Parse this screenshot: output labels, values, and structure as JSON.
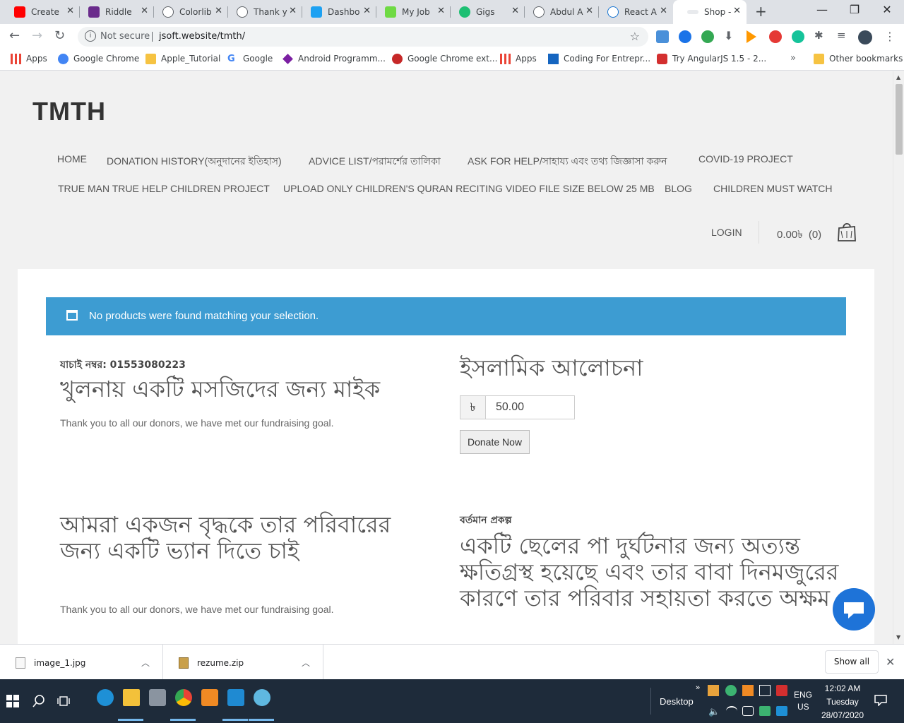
{
  "browser": {
    "tabs": [
      {
        "label": "Create",
        "color": "#ff0000"
      },
      {
        "label": "Riddle",
        "color": "#6a2b8c"
      },
      {
        "label": "Colorlib",
        "color": "#5f6368"
      },
      {
        "label": "Thank y",
        "color": "#5f6368"
      },
      {
        "label": "Dashbo",
        "color": "#1da1f2"
      },
      {
        "label": "My Job",
        "color": "#6fda44"
      },
      {
        "label": "Gigs",
        "color": "#1dbf73"
      },
      {
        "label": "Abdul A",
        "color": "#5f6368"
      },
      {
        "label": "React A",
        "color": "#1976d2"
      },
      {
        "label": "Shop - ",
        "color": "#9aa0a6"
      }
    ],
    "tab_close": "✕",
    "new_tab": "+",
    "window_controls": {
      "minimize": "—",
      "restore": "❐",
      "close": "✕"
    },
    "security_label": "Not secure",
    "url": "jsoft.website/tmth/",
    "bookmarks": [
      {
        "label": "Apps",
        "color": "#ea4335"
      },
      {
        "label": "Google Chrome",
        "color": "#4285f4"
      },
      {
        "label": "Apple_Tutorial",
        "color": "#f6c342"
      },
      {
        "label": "Google",
        "color": "#4285f4"
      },
      {
        "label": "Android Programm...",
        "color": "#7b1fa2"
      },
      {
        "label": "Google Chrome ext...",
        "color": "#c62828"
      },
      {
        "label": "Apps",
        "color": "#ea4335"
      },
      {
        "label": "Coding For Entrepr...",
        "color": "#1565c0"
      },
      {
        "label": "Try AngularJS 1.5 - 2...",
        "color": "#d32f2f"
      }
    ],
    "bookmarks_more": "»",
    "other_bookmarks": "Other bookmarks"
  },
  "site": {
    "title": "TMTH",
    "menu_row1": [
      "HOME",
      "DONATION HISTORY(অনুদানের ইতিহাস)",
      "ADVICE LIST/পরামর্শের তালিকা",
      "ASK FOR HELP/সাহায্য এবং তথ্য জিজ্ঞাসা করুন",
      "COVID-19 PROJECT"
    ],
    "menu_row2": [
      "TRUE MAN TRUE HELP CHILDREN PROJECT",
      "UPLOAD ONLY CHILDREN'S QURAN RECITING VIDEO FILE SIZE BELOW 25 MB",
      "BLOG",
      "CHILDREN MUST WATCH"
    ],
    "login": "LOGIN",
    "cart_total": "0.00৳",
    "cart_count": "(0)"
  },
  "main": {
    "notice": "No products were found matching your selection.",
    "campaign1": {
      "subtitle": "যাচাই নম্বর: 01553080223",
      "title": "খুলনায় একটি মসজিদের জন্য মাইক",
      "status": "Thank you to all our donors, we have met our fundraising goal."
    },
    "campaign2": {
      "title": "ইসলামিক আলোচনা",
      "currency": "৳",
      "amount": "50.00",
      "button": "Donate Now"
    },
    "campaign3": {
      "title": "আমরা একজন বৃদ্ধকে তার পরিবারের জন্য একটি ভ্যান দিতে চাই",
      "status": "Thank you to all our donors, we have met our fundraising goal."
    },
    "campaign4": {
      "subtitle": "বর্তমান প্রকল্প",
      "title": "একটি ছেলের পা দুর্ঘটনার জন্য অত্যন্ত ক্ষতিগ্রস্থ হয়েছে এবং তার বাবা দিনমজুরের কারণে তার পরিবার সহায়তা করতে অক্ষম"
    }
  },
  "downloads": {
    "items": [
      "image_1.jpg",
      "rezume.zip"
    ],
    "show_all": "Show all"
  },
  "taskbar": {
    "desktop_label": "Desktop",
    "lang_line1": "ENG",
    "lang_line2": "US",
    "time": "12:02 AM",
    "day": "Tuesday",
    "date": "28/07/2020"
  }
}
